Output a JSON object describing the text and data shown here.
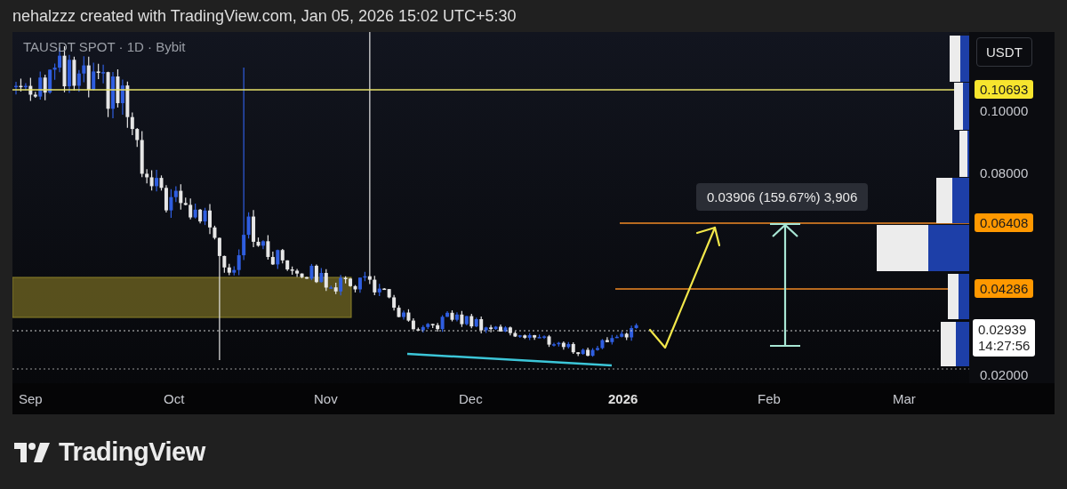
{
  "header": {
    "caption": "nehalzzz created with TradingView.com, Jan 05, 2026 15:02 UTC+5:30"
  },
  "chart": {
    "symbol": "TAUSDT SPOT · 1D · Bybit",
    "currency": "USDT",
    "measure_label": "0.03906 (159.67%) 3,906",
    "price_labels": [
      {
        "text": "0.10693",
        "kind": "marker",
        "color": "#f7e52e"
      },
      {
        "text": "0.10000",
        "kind": "tick"
      },
      {
        "text": "0.08000",
        "kind": "tick"
      },
      {
        "text": "0.06408",
        "kind": "marker",
        "color": "#ff9800"
      },
      {
        "text": "0.04286",
        "kind": "marker",
        "color": "#ff9800"
      },
      {
        "text": "0.02000",
        "kind": "tick"
      }
    ],
    "last_price": {
      "price": "0.02939",
      "countdown": "14:27:56"
    },
    "time_labels": [
      {
        "text": "Sep",
        "kind": "month"
      },
      {
        "text": "Oct",
        "kind": "month"
      },
      {
        "text": "Nov",
        "kind": "month"
      },
      {
        "text": "Dec",
        "kind": "month"
      },
      {
        "text": "2026",
        "kind": "year"
      },
      {
        "text": "Feb",
        "kind": "month"
      },
      {
        "text": "Mar",
        "kind": "month"
      }
    ]
  },
  "footer": {
    "brand": "TradingView"
  }
}
